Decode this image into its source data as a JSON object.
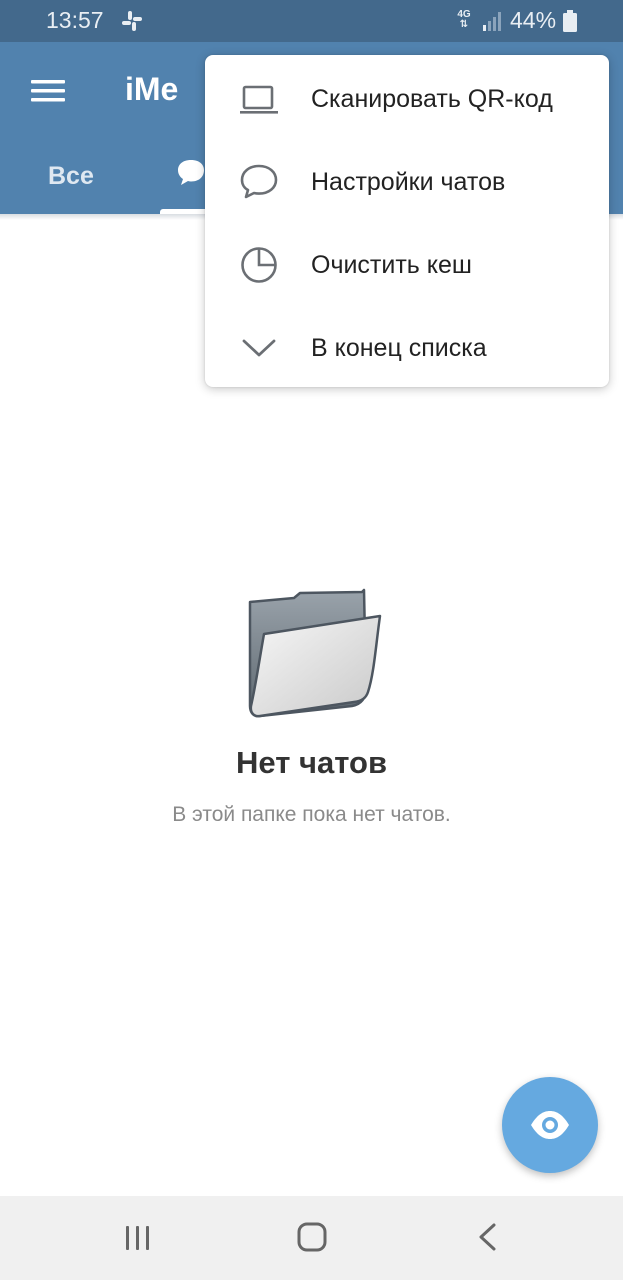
{
  "status_bar": {
    "time": "13:57",
    "notification_icon": "slack-icon",
    "network_type": "4G",
    "battery": "44%"
  },
  "app_bar": {
    "title": "iMe",
    "menu_icon": "hamburger-menu-icon",
    "tabs": [
      {
        "label": "Все",
        "selected": false
      },
      {
        "icon": "chat-bubbles-icon",
        "selected": true
      }
    ]
  },
  "popup_menu": {
    "items": [
      {
        "icon": "laptop-icon",
        "label": "Сканировать QR-код"
      },
      {
        "icon": "chat-bubble-icon",
        "label": "Настройки чатов"
      },
      {
        "icon": "pie-chart-icon",
        "label": "Очистить кеш"
      },
      {
        "icon": "chevron-down-icon",
        "label": "В конец списка"
      }
    ]
  },
  "empty_state": {
    "icon": "empty-folder-icon",
    "title": "Нет чатов",
    "subtitle": "В этой папке пока нет чатов."
  },
  "fab": {
    "icon": "eye-icon",
    "color": "#65a9e0"
  },
  "colors": {
    "status_bar": "#43698c",
    "app_bar": "#5182ae",
    "accent": "#65a9e0"
  },
  "nav_bar": {
    "items": [
      "recents-icon",
      "home-icon",
      "back-icon"
    ]
  }
}
